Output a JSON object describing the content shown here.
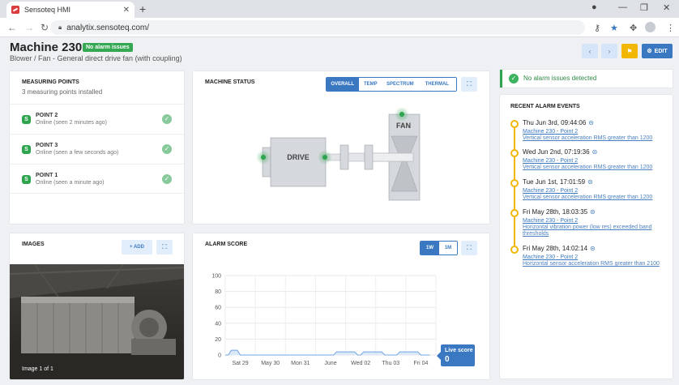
{
  "browser": {
    "tab_title": "Sensoteq HMI",
    "url": "analytix.sensoteq.com/"
  },
  "header": {
    "title": "Machine 230",
    "badge": "No alarm issues",
    "subtitle": "Blower / Fan - General direct drive fan (with coupling)",
    "edit_label": "EDIT"
  },
  "measuring_points": {
    "title": "MEASURING POINTS",
    "subtitle": "3 measuring points installed",
    "items": [
      {
        "icon": "S",
        "name": "POINT 2",
        "status": "Online (seen 2 minutes ago)"
      },
      {
        "icon": "S",
        "name": "POINT 3",
        "status": "Online (seen a few seconds ago)"
      },
      {
        "icon": "S",
        "name": "POINT 1",
        "status": "Online (seen a minute ago)"
      }
    ]
  },
  "machine_status": {
    "title": "MACHINE STATUS",
    "tabs": [
      "OVERALL",
      "TEMP",
      "SPECTRUM",
      "THERMAL"
    ],
    "active_tab": "OVERALL",
    "drive_label": "DRIVE",
    "fan_label": "FAN",
    "status_color": "#2ea44f"
  },
  "images": {
    "title": "IMAGES",
    "add_label": "+ ADD",
    "caption": "Image 1 of 1"
  },
  "alarm_score": {
    "title": "ALARM SCORE",
    "ranges": [
      "1W",
      "1M"
    ],
    "active_range": "1W",
    "live_label": "Live score",
    "live_value": "0"
  },
  "chart_data": {
    "type": "area",
    "title": "",
    "xlabel": "",
    "ylabel": "",
    "ylim": [
      0,
      100
    ],
    "yticks": [
      0,
      20,
      40,
      60,
      80,
      100
    ],
    "categories": [
      "Sat 29",
      "May 30",
      "Mon 31",
      "June",
      "Wed 02",
      "Thu 03",
      "Fri 04"
    ],
    "series": [
      {
        "x": [
          0,
          0.1,
          0.2,
          0.4,
          0.5,
          2.6,
          3.0,
          3.6,
          3.7,
          4.3,
          4.4,
          4.5,
          4.6,
          5.2,
          5.3,
          5.7,
          5.8,
          6.4,
          6.5,
          6.8
        ],
        "values": [
          0,
          0,
          6,
          6,
          0,
          0,
          0,
          0,
          4,
          4,
          0,
          0,
          4,
          4,
          0,
          0,
          4,
          4,
          0,
          0
        ]
      }
    ],
    "grid": true,
    "colors": {
      "line": "#6fa3e0",
      "fill": "#dbe8f7"
    }
  },
  "alarm_banner": "No alarm issues detected",
  "alarm_events": {
    "title": "RECENT ALARM EVENTS",
    "items": [
      {
        "date": "Thu Jun 3rd, 09:44:06",
        "machine": "Machine 230",
        "sep": " - ",
        "point": "Point 2",
        "desc": "Vertical sensor acceleration RMS greater than 1200"
      },
      {
        "date": "Wed Jun 2nd, 07:19:36",
        "machine": "Machine 230",
        "sep": " - ",
        "point": "Point 2",
        "desc": "Vertical sensor acceleration RMS greater than 1200"
      },
      {
        "date": "Tue Jun 1st, 17:01:59",
        "machine": "Machine 230",
        "sep": " - ",
        "point": "Point 2",
        "desc": "Vertical sensor acceleration RMS greater than 1200"
      },
      {
        "date": "Fri May 28th, 18:03:35",
        "machine": "Machine 230",
        "sep": " - ",
        "point": "Point 2",
        "desc": "Horizontal vibration power (low res) exceeded band thresholds"
      },
      {
        "date": "Fri May 28th, 14:02:14",
        "machine": "Machine 230",
        "sep": " - ",
        "point": "Point 2",
        "desc": "Horizontal sensor acceleration RMS greater than 2100"
      }
    ]
  }
}
